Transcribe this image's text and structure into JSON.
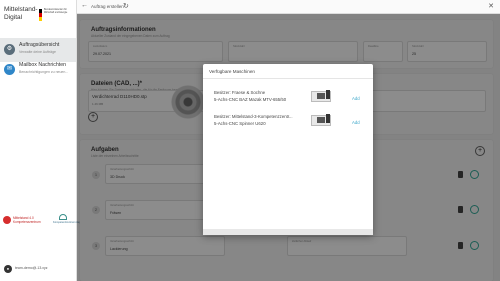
{
  "app": {
    "brand_line1": "Mittelstand-",
    "brand_line2": "Digital",
    "ministry_text": "Bundesministerium für Wirtschaft und Energie",
    "colors": {
      "accent": "#3aa6c9",
      "nav_active_icon": "#5a6d7a",
      "mailbox_icon": "#2f86c8"
    }
  },
  "sidebar": {
    "items": [
      {
        "title": "Auftragsübersicht",
        "subtitle": "Verwalte deine Aufträge",
        "icon": "orders-icon"
      },
      {
        "title": "Mailbox Nachrichten",
        "subtitle": "Benachrichtigungen zu neuen...",
        "icon": "mailbox-icon"
      }
    ],
    "logo_a": "Mittelstand 4.0 Kompetenzzentrum",
    "logo_b": "Kompetenzzentrum Augsburg",
    "user_email": "team-demo@-13.xyz"
  },
  "topbar": {
    "title": "Auftrag erstellen",
    "back_icon": "arrow-left-icon",
    "refresh_icon": "refresh-icon"
  },
  "main": {
    "order_info": {
      "title": "Auftragsinformationen",
      "subtitle": "Aktueller Zustand der eingegebenen Daten zum Auftrag",
      "fields": [
        {
          "label": "Lieferdatum",
          "value": "29.07.2021"
        },
        {
          "label": "Stückzahl",
          "value": ""
        },
        {
          "label": "Deadline",
          "value": ""
        },
        {
          "label": "Stückzahl",
          "value": "25"
        }
      ]
    },
    "files": {
      "title": "Dateien (CAD, ...)*",
      "subtitle": "Hier können Sie Dateien hochladen, die für die Fertigung benötigt werden",
      "file_name": "Verdichterrad D110HD0.stp",
      "file_size": "1.46 MB"
    },
    "tasks": {
      "title": "Aufgaben",
      "subtitle": "Liste der einzelnen Arbeitsschritte",
      "rows": [
        {
          "number": "1",
          "label": "Verarbeitungsschritt",
          "value": "3D Druck"
        },
        {
          "number": "2",
          "label": "Verarbeitungsschritt",
          "value": "Fräsen"
        },
        {
          "number": "3",
          "label": "Verarbeitungsschritt",
          "value": "Lackierung"
        },
        {
          "number": "4",
          "label": "Verarbeitungsschritt",
          "value": "Drehen",
          "extra_label": "Zeitlicher Ablauf"
        }
      ]
    }
  },
  "modal": {
    "title": "Verfügbare Maschinen",
    "machines": [
      {
        "owner": "Besitzer: Fraese & Sochne",
        "type": "5-Achs-CNC BAZ Mazak MTV-655/50",
        "action": "Add"
      },
      {
        "owner": "Besitzer: Mittelstand-3-Kompetenzzentr...",
        "type": "5-Achs-CNC Spinner U620",
        "action": "Add"
      }
    ]
  }
}
